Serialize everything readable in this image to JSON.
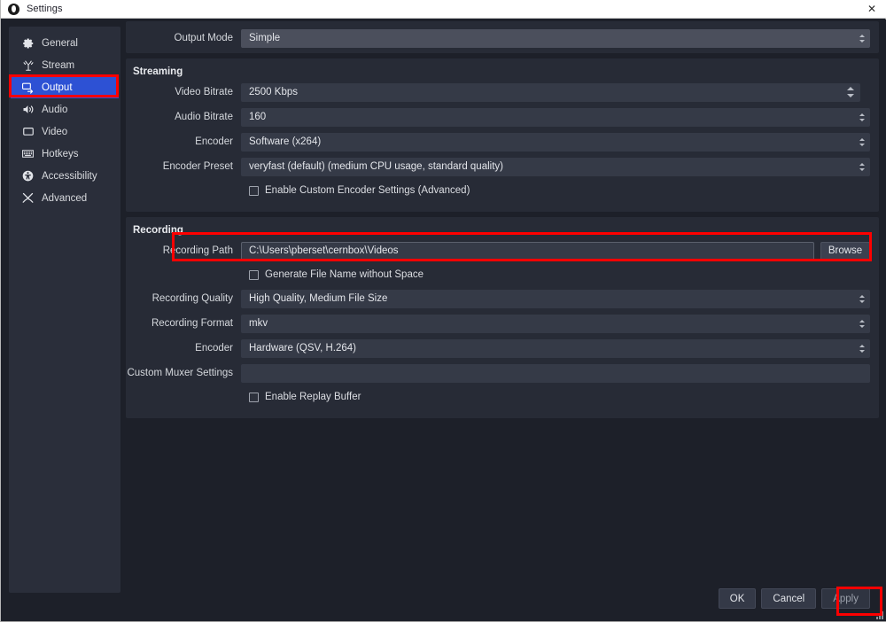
{
  "window": {
    "title": "Settings",
    "app_icon": "obs-logo-icon",
    "close_icon": "✕"
  },
  "sidebar": {
    "items": [
      {
        "label": "General",
        "icon": "gear-icon",
        "selected": false
      },
      {
        "label": "Stream",
        "icon": "broadcast-icon",
        "selected": false
      },
      {
        "label": "Output",
        "icon": "output-display-icon",
        "selected": true
      },
      {
        "label": "Audio",
        "icon": "speaker-icon",
        "selected": false
      },
      {
        "label": "Video",
        "icon": "monitor-icon",
        "selected": false
      },
      {
        "label": "Hotkeys",
        "icon": "keyboard-icon",
        "selected": false
      },
      {
        "label": "Accessibility",
        "icon": "accessibility-icon",
        "selected": false
      },
      {
        "label": "Advanced",
        "icon": "tools-icon",
        "selected": false
      }
    ]
  },
  "main": {
    "output_mode": {
      "label": "Output Mode",
      "value": "Simple"
    },
    "streaming": {
      "title": "Streaming",
      "video_bitrate": {
        "label": "Video Bitrate",
        "value": "2500 Kbps"
      },
      "audio_bitrate": {
        "label": "Audio Bitrate",
        "value": "160"
      },
      "encoder": {
        "label": "Encoder",
        "value": "Software (x264)"
      },
      "encoder_preset": {
        "label": "Encoder Preset",
        "value": "veryfast (default) (medium CPU usage, standard quality)"
      },
      "custom_encoder_checkbox": {
        "label": "Enable Custom Encoder Settings (Advanced)",
        "checked": false
      }
    },
    "recording": {
      "title": "Recording",
      "recording_path": {
        "label": "Recording Path",
        "value": "C:\\Users\\pberset\\cernbox\\Videos",
        "browse_label": "Browse"
      },
      "generate_filename_checkbox": {
        "label": "Generate File Name without Space",
        "checked": false
      },
      "recording_quality": {
        "label": "Recording Quality",
        "value": "High Quality, Medium File Size"
      },
      "recording_format": {
        "label": "Recording Format",
        "value": "mkv"
      },
      "encoder": {
        "label": "Encoder",
        "value": "Hardware (QSV, H.264)"
      },
      "custom_muxer": {
        "label": "Custom Muxer Settings",
        "value": ""
      },
      "replay_buffer_checkbox": {
        "label": "Enable Replay Buffer",
        "checked": false
      }
    }
  },
  "footer": {
    "ok": "OK",
    "cancel": "Cancel",
    "apply": "Apply"
  },
  "annotations": {
    "highlight_color": "#fe0000",
    "boxes": [
      "sidebar-output-item",
      "recording-path-row",
      "apply-button"
    ]
  },
  "colors": {
    "selection_blue": "#2d51d4",
    "panel_bg": "#272b36",
    "window_bg": "#1d2029",
    "field_bg": "#353a47",
    "field_active_bg": "#4b4f5c"
  }
}
